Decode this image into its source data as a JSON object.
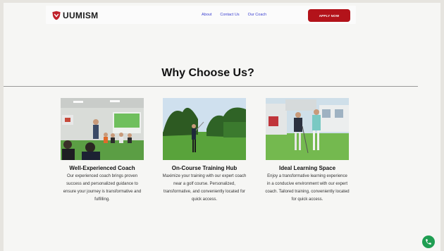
{
  "brand": {
    "name": "UUMISM",
    "logo_color": "#c0212a"
  },
  "nav": {
    "links": [
      "About",
      "Contact Us",
      "Our Coach"
    ],
    "cta_label": "APPLY NOW",
    "cta_color": "#b3131a",
    "link_color": "#3a3fd0"
  },
  "section": {
    "title": "Why Choose Us?",
    "features": [
      {
        "photo": "classroom-coaching-photo",
        "title": "Well-Experienced Coach",
        "description_lines": [
          "Our experienced coach brings proven",
          "success and personalized guidance to",
          "ensure your journey is transformative and",
          "fulfilling."
        ]
      },
      {
        "photo": "golf-course-swing-photo",
        "title": "On-Course Training Hub",
        "description_lines": [
          "Maximize your training with our expert coach",
          "near a golf course. Personalized,",
          "transformative, and conveniently located for",
          "quick access."
        ]
      },
      {
        "photo": "coach-guiding-golfer-photo",
        "title": "Ideal Learning Space",
        "description_lines": [
          "Enjoy a transformative learning experience",
          "in a conducive environment with our expert",
          "coach. Tailored training, conveniently located",
          "for quick access."
        ]
      }
    ]
  },
  "floating": {
    "icon": "whatsapp-phone-icon",
    "color": "#1f9e52"
  }
}
